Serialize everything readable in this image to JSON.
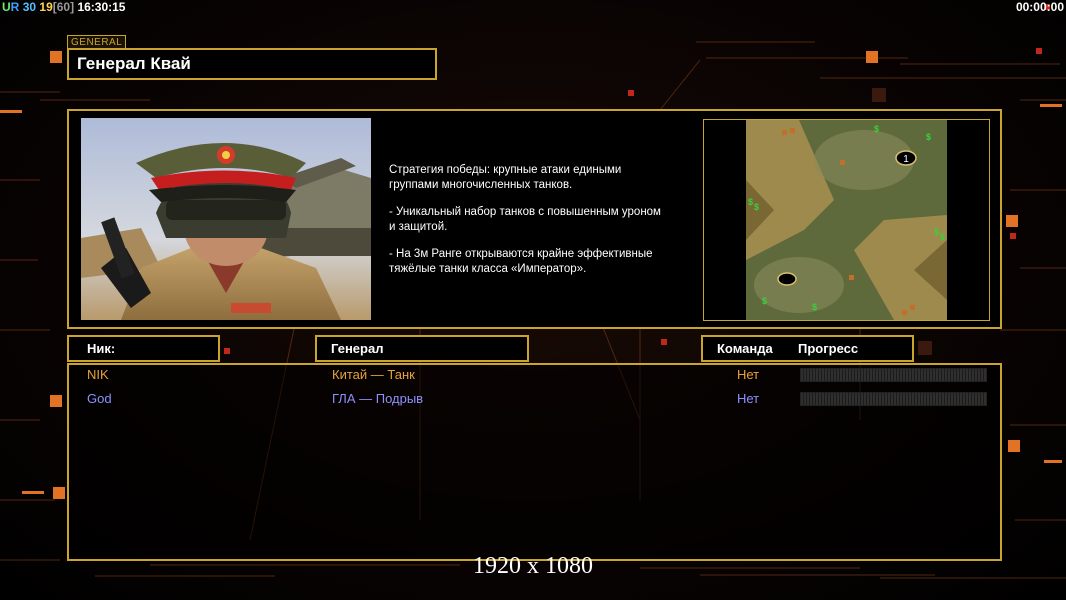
{
  "status_bar": {
    "ur_u": "U",
    "ur_r": "R",
    "num1": "30",
    "num2": "19",
    "num3": "[60]",
    "clock": "16:30:15",
    "timer": "00:00:00"
  },
  "general": {
    "tag": "GENERAL",
    "name": "Генерал Квай"
  },
  "description": {
    "line1": "Стратегия победы: крупные атаки едиными\n группами многочисленных танков.",
    "line2": "- Уникальный набор танков с повышенным уроном\n и защитой.",
    "line3": "- На 3м Ранге открываются крайне эффективные\n тяжёлые танки класса «Император»."
  },
  "minimap": {
    "start_marker": "1"
  },
  "headers": {
    "nick": "Ник:",
    "general": "Генерал",
    "team": "Команда",
    "progress": "Прогресс"
  },
  "players": [
    {
      "nick": "NIK",
      "general": "Китай — Танк",
      "team": "Нет",
      "progress": 0,
      "color": "#e8a23a"
    },
    {
      "nick": "God",
      "general": "ГЛА — Подрыв",
      "team": "Нет",
      "progress": 0,
      "color": "#8f8fff"
    }
  ],
  "resolution": "1920 x 1080",
  "colors": {
    "accent_gold": "#c9a52c",
    "player1": "#e8a23a",
    "player2": "#8f8fff"
  }
}
